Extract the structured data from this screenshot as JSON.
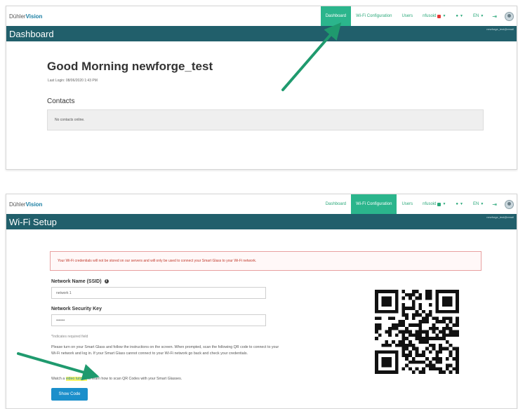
{
  "colors": {
    "brand_green": "#2bb58c",
    "title_bar": "#215f6b",
    "button_blue": "#1b8fcb",
    "annotation_arrow": "#1f9a6e",
    "highlight": "#f7f56a"
  },
  "nav": {
    "logo_part1": "Dühler",
    "logo_part2": "Vision",
    "dashboard": "Dashboard",
    "wifi_config": "Wi-Fi Configuration",
    "users": "Users",
    "user_menu": "nfusoid",
    "status_menu": "●",
    "language": "EN",
    "logout_icon": "⇥",
    "avatar_icon": "user-avatar"
  },
  "dashboard": {
    "title": "Dashboard",
    "account": "newforge_test@email",
    "greeting": "Good Morning newforge_test",
    "last_login": "Last Login: 08/06/2020 1:43 PM",
    "contacts_heading": "Contacts",
    "no_contacts": "No contacts online."
  },
  "wifi": {
    "title": "Wi-Fi Setup",
    "account": "newforge_test@email",
    "warning": "Your Wi-Fi credentials will not be stored on our servers and will only be used to connect your Smart Glass to your Wi-Fi network.",
    "network_name_label": "Network Name (SSID)",
    "network_name_value": "network 1",
    "security_key_label": "Network Security Key",
    "security_key_value": "•••••••",
    "required_note": "*Indicates required field",
    "instructions": "Please turn on your Smart Glass and follow the instructions on the screen. When prompted, scan the following QR code to connect to your Wi-Fi network and log in. If your Smart Glass cannot connect to your Wi-Fi network go back and check your credentials.",
    "watch_prefix": "Watch a ",
    "watch_link": "video tutorial",
    "watch_suffix": " to learn how to scan QR Codes with your Smart Glasses.",
    "show_code": "Show Code"
  }
}
